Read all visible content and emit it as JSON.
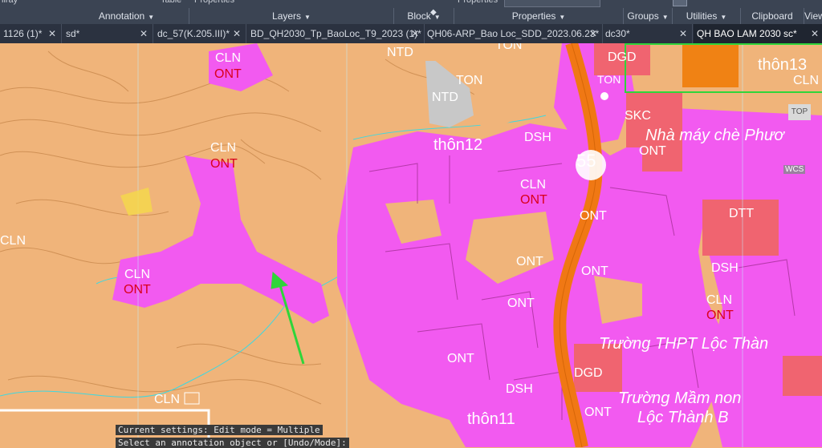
{
  "ribbon": {
    "top_fragments": [
      "ilray",
      "Table",
      "Properties",
      "Properties"
    ],
    "panels": [
      "Annotation",
      "Layers",
      "Block",
      "Properties",
      "Groups",
      "Utilities",
      "Clipboard",
      "View"
    ]
  },
  "tabs": [
    {
      "label": "1126 (1)*",
      "active": false
    },
    {
      "label": "sd*",
      "active": false
    },
    {
      "label": "dc_57(K.205.III)*",
      "active": false
    },
    {
      "label": "BD_QH2030_Tp_BaoLoc_T9_2023 (1)*",
      "active": false
    },
    {
      "label": "QH06-ARP_Bao Loc_SDD_2023.06.23*",
      "active": false
    },
    {
      "label": "dc30*",
      "active": false
    },
    {
      "label": "QH BAO LAM 2030 sc*",
      "active": true
    }
  ],
  "map": {
    "labels": {
      "cln1": "CLN",
      "ont1": "ONT",
      "ntd1": "NTD",
      "ton1": "TON",
      "ntd2": "NTD",
      "ton2": "TON",
      "dgd1": "DGD",
      "ton3": "TON",
      "thon13": "thôn13",
      "cln_tr": "CLN",
      "skc": "SKC",
      "nha_may": "Nhà máy chè Phươ",
      "thon12": "thôn12",
      "dsh1": "DSH",
      "ont_tc": "ONT",
      "cln2": "CLN",
      "ont2": "ONT",
      "cln_l": "CLN",
      "cln3": "CLN",
      "ont3": "ONT",
      "ont4": "ONT",
      "dtt": "DTT",
      "ont5": "ONT",
      "ont6": "ONT",
      "dsh2": "DSH",
      "cln4": "CLN",
      "ont7": "ONT",
      "ont8": "ONT",
      "truong_thpt": "Trường THPT Lộc Thàn",
      "ont9": "ONT",
      "dgd2": "DGD",
      "dsh3": "DSH",
      "truong_mn": "Trường Mầm non",
      "loc_thanh_b": "Lộc Thành B",
      "cln5": "CLN",
      "thon11": "thôn11",
      "ont10": "ONT",
      "route": "55",
      "top_badge": "TOP",
      "wcs": "WCS"
    },
    "colors": {
      "rural_pink": "#f25af0",
      "orchard_orange": "#f0b47a",
      "road_orange": "#f07814",
      "public_red": "#f06470",
      "dark_orange": "#f08214",
      "highlight_green": "#2fd53a"
    }
  },
  "command": {
    "line1": "Current settings: Edit mode = Multiple",
    "line2": "Select an annotation object or [Undo/Mode]:"
  }
}
